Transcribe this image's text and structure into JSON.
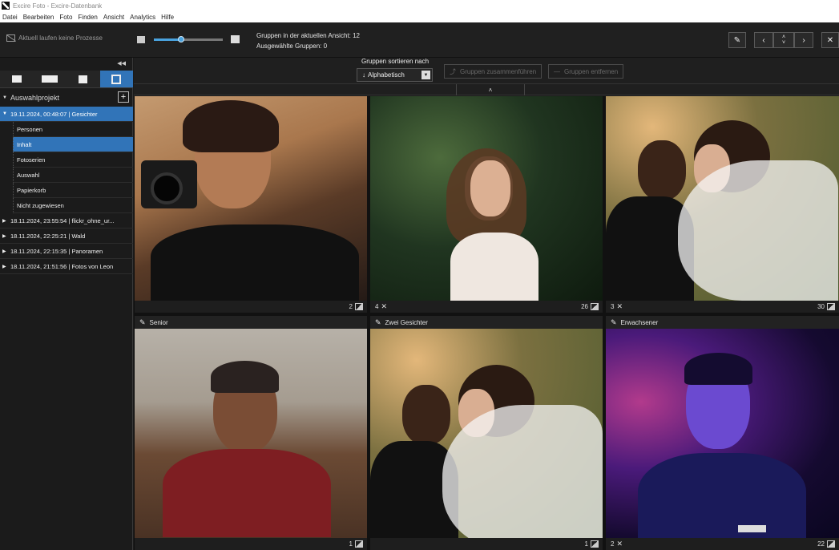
{
  "window": {
    "title": "Excire Foto - Excire-Datenbank"
  },
  "menu": [
    "Datei",
    "Bearbeiten",
    "Foto",
    "Finden",
    "Ansicht",
    "Analytics",
    "Hilfe"
  ],
  "toolbar": {
    "process_status": "Aktuell laufen keine Prozesse",
    "thumbnail_size_fraction": 0.4,
    "groups_in_view": "Gruppen in der aktuellen Ansicht: 12",
    "selected_groups": "Ausgewählte Gruppen: 0"
  },
  "sidebar": {
    "project_label": "Auswahlprojekt",
    "add_button": "+",
    "tree": [
      {
        "label": "19.11.2024, 00:48:07 | Gesichter",
        "expanded": true,
        "selected": true,
        "children": [
          {
            "label": "Personen",
            "selected": false
          },
          {
            "label": "Inhalt",
            "selected": true
          },
          {
            "label": "Fotoserien",
            "selected": false
          },
          {
            "label": "Auswahl",
            "selected": false
          },
          {
            "label": "Papierkorb",
            "selected": false
          },
          {
            "label": "Nicht zugewiesen",
            "selected": false
          }
        ]
      },
      {
        "label": "18.11.2024, 23:55:54 | flickr_ohne_ur...",
        "expanded": false
      },
      {
        "label": "18.11.2024, 22:25:21 | Wald",
        "expanded": false
      },
      {
        "label": "18.11.2024, 22:15:35 | Panoramen",
        "expanded": false
      },
      {
        "label": "18.11.2024, 21:51:56 | Fotos von Leon",
        "expanded": false
      }
    ]
  },
  "sortbar": {
    "sort_label": "Gruppen sortieren nach",
    "sort_value": "Alphabetisch",
    "merge_button": "Gruppen zusammenführen",
    "remove_button": "Gruppen entfernen"
  },
  "groups": [
    {
      "name": "",
      "left_count": "",
      "right_count": "2"
    },
    {
      "name": "",
      "left_count": "4",
      "right_count": "26"
    },
    {
      "name": "",
      "left_count": "3",
      "right_count": "30"
    },
    {
      "name": "Senior",
      "left_count": "",
      "right_count": "1"
    },
    {
      "name": "Zwei Gesichter",
      "left_count": "",
      "right_count": "1"
    },
    {
      "name": "Erwachsener",
      "left_count": "2",
      "right_count": "22"
    }
  ]
}
